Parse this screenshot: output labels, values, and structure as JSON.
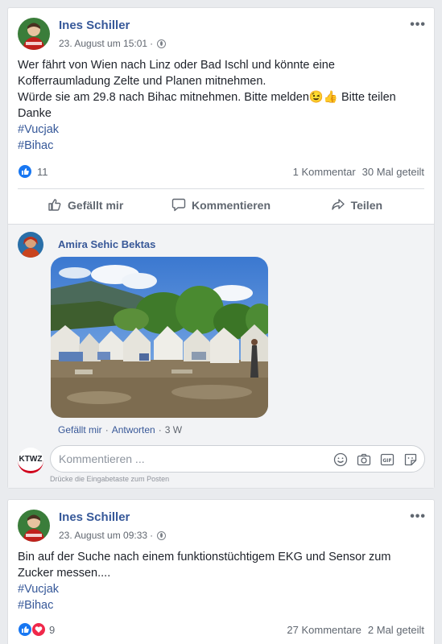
{
  "posts": [
    {
      "author": "Ines Schiller",
      "date": "23. August um 15:01",
      "menu": "•••",
      "text_lines": [
        "Wer fährt von Wien nach Linz oder Bad Ischl und könnte eine",
        "Kofferraumladung Zelte und Planen mitnehmen.",
        "Würde sie am 29.8 nach Bihac mitnehmen. Bitte melden😉👍 Bitte teilen",
        "Danke"
      ],
      "hashtags": [
        "#Vucjak",
        "#Bihac"
      ],
      "reaction_count": "11",
      "comments_count": "1 Kommentar",
      "shares_count": "30 Mal geteilt",
      "actions": {
        "like": "Gefällt mir",
        "comment": "Kommentieren",
        "share": "Teilen"
      },
      "comment": {
        "author": "Amira Sehic Bektas",
        "like_link": "Gefällt mir",
        "separator": "·",
        "reply_link": "Antworten",
        "age": "3 W"
      },
      "comment_box": {
        "avatar_text": "KTWZ",
        "placeholder": "Kommentieren ...",
        "hint": "Drücke die Eingabetaste zum Posten"
      }
    },
    {
      "author": "Ines Schiller",
      "date": "23. August um 09:33",
      "menu": "•••",
      "text_lines": [
        "Bin auf der Suche nach einem funktionstüchtigem EKG und Sensor zum",
        "Zucker messen...."
      ],
      "hashtags": [
        "#Vucjak",
        "#Bihac"
      ],
      "reaction_count": "9",
      "comments_count": "27 Kommentare",
      "shares_count": "2 Mal geteilt"
    }
  ],
  "icons": [
    "globe-icon",
    "like-icon",
    "love-icon",
    "comment-icon",
    "share-icon",
    "emoji-icon",
    "camera-icon",
    "gif-icon",
    "sticker-icon"
  ],
  "colors": {
    "link": "#365899",
    "like": "#1877f2",
    "love": "#f0284a",
    "background": "#e9ebee"
  }
}
